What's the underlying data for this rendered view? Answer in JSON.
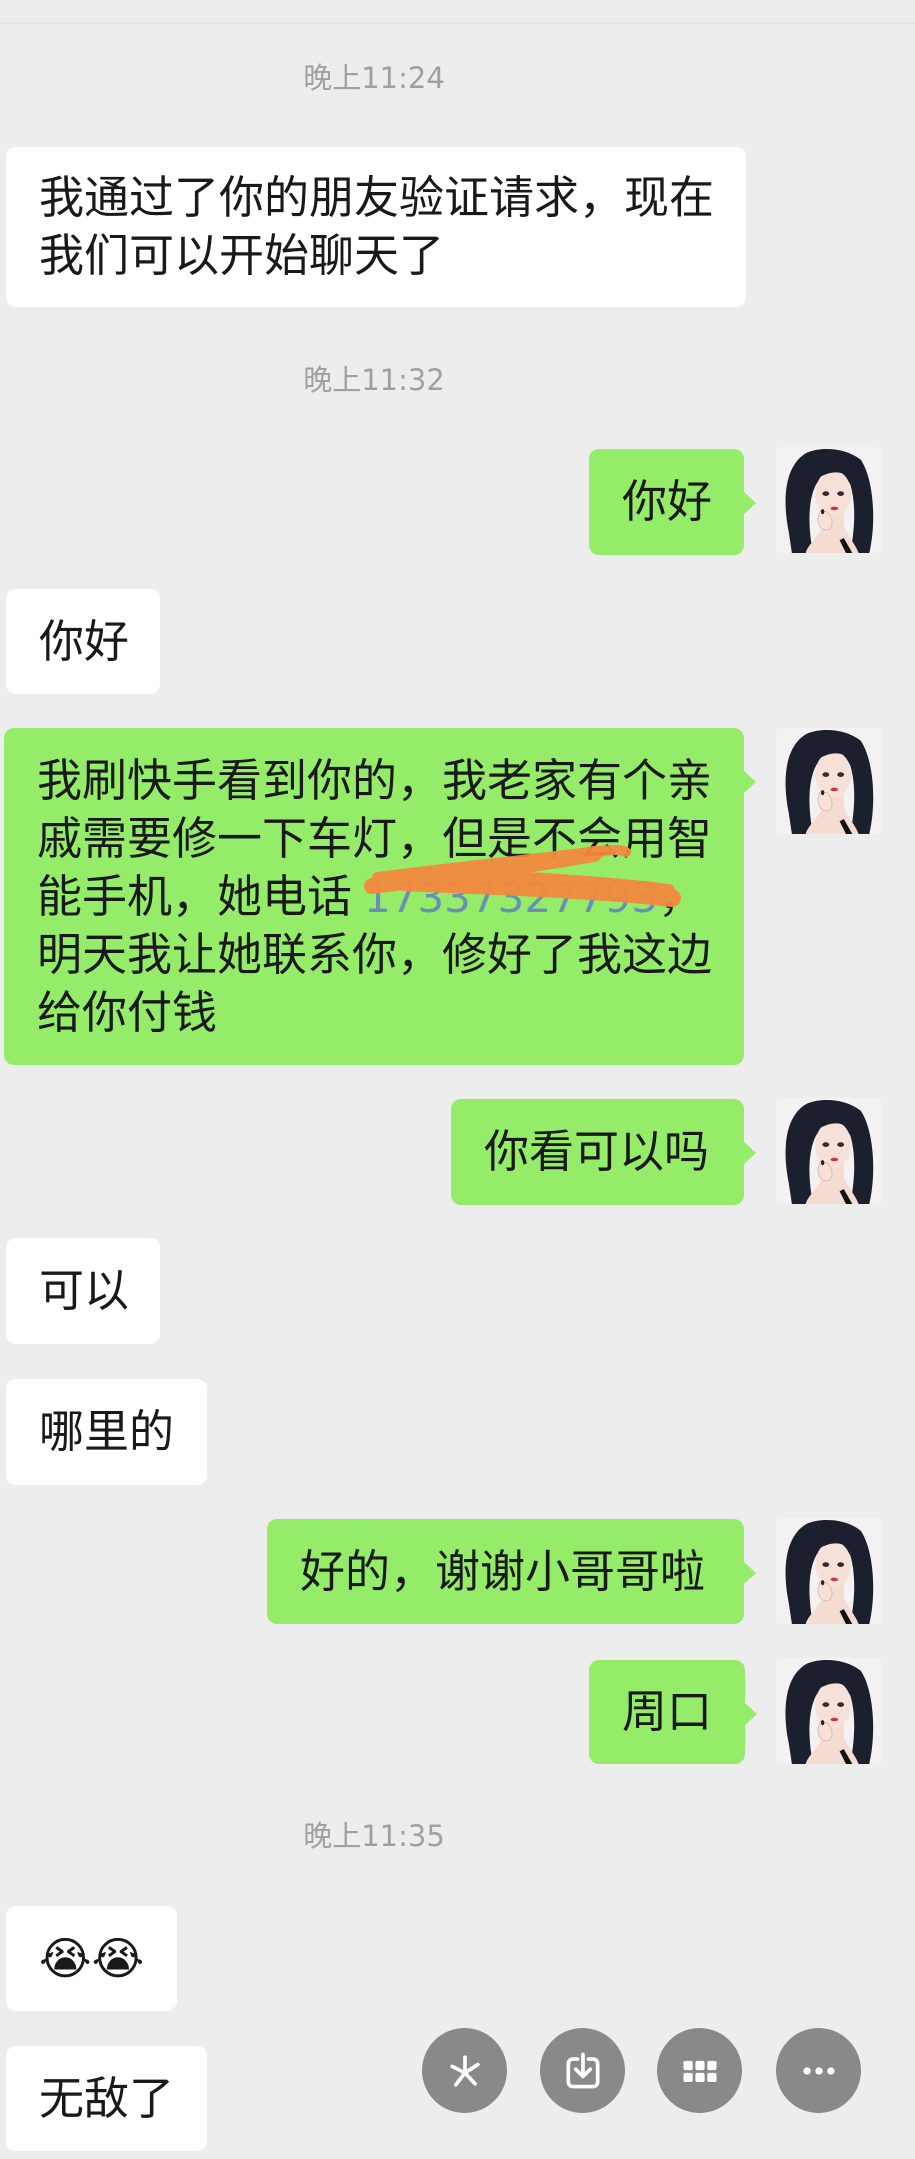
{
  "colors": {
    "background": "#ededed",
    "self_bubble": "#95ec69",
    "other_bubble": "#ffffff",
    "timestamp": "#a0a0a0",
    "phone_link": "#6a8fb5",
    "redaction_scribble": "#f3893f",
    "floating_button": "#808080"
  },
  "timestamps": [
    "晚上11:24",
    "晚上11:32",
    "晚上11:35"
  ],
  "messages": [
    {
      "lines": [
        "我通过了你的朋友验证请求，现在",
        "我们可以开始聊天了"
      ]
    },
    {
      "lines": [
        "你好"
      ]
    },
    {
      "lines": [
        "你好"
      ]
    },
    {
      "lines": [
        "我刷快手看到你的，我老家有个亲",
        "戚需要修一下车灯，但是不会用智",
        "能手机，她电话",
        "明天我让她联系你，修好了我这边",
        "给你付钱"
      ],
      "phone": "17337327793",
      "phone_suffix": "，"
    },
    {
      "lines": [
        "你看可以吗"
      ]
    },
    {
      "lines": [
        "可以"
      ]
    },
    {
      "lines": [
        "哪里的"
      ]
    },
    {
      "lines": [
        "好的，谢谢小哥哥啦"
      ]
    },
    {
      "lines": [
        "周口"
      ]
    },
    {
      "lines": [
        "😭😭"
      ]
    },
    {
      "lines": [
        "无敌了"
      ]
    }
  ],
  "avatar": {
    "icon": "avatar-anime-girl-icon"
  },
  "floating_toolbar": {
    "buttons": [
      {
        "icon": "sparkle-icon"
      },
      {
        "icon": "download-icon"
      },
      {
        "icon": "grid-icon"
      },
      {
        "icon": "more-icon"
      }
    ]
  }
}
